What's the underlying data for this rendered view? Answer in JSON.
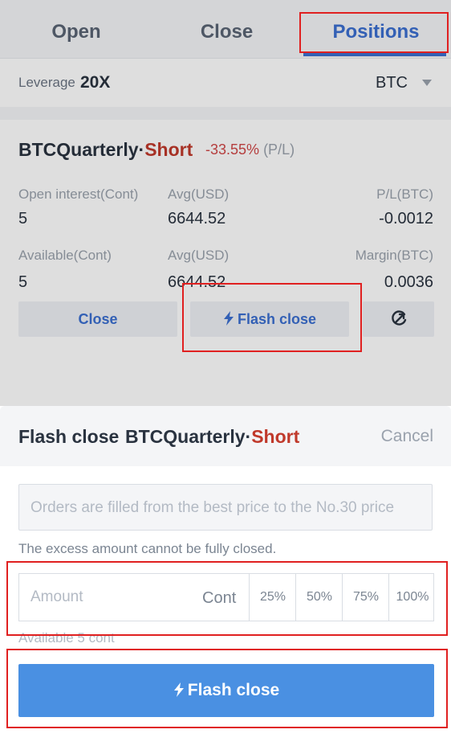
{
  "tabs": [
    {
      "label": "Open"
    },
    {
      "label": "Close"
    },
    {
      "label": "Positions"
    }
  ],
  "leverage": {
    "label": "Leverage",
    "value": "20X",
    "coin": "BTC"
  },
  "position": {
    "contract": "BTCQuarterly·",
    "side": "Short",
    "pl_percent": "-33.55%",
    "pl_suffix": "(P/L)",
    "fields": {
      "open_interest_label": "Open interest(Cont)",
      "open_interest_value": "5",
      "avg1_label": "Avg(USD)",
      "avg1_value": "6644.52",
      "pl_btc_label": "P/L(BTC)",
      "pl_btc_value": "-0.0012",
      "available_label": "Available(Cont)",
      "available_value": "5",
      "avg2_label": "Avg(USD)",
      "avg2_value": "6644.52",
      "margin_label": "Margin(BTC)",
      "margin_value": "0.0036"
    },
    "buttons": {
      "close": "Close",
      "flash_close": "Flash close"
    }
  },
  "sheet": {
    "title": "Flash close",
    "contract": "BTCQuarterly·",
    "side": "Short",
    "cancel": "Cancel",
    "order_info": "Orders are filled from the best price to the No.30 price",
    "hint": "The excess amount cannot be fully closed.",
    "amount_placeholder": "Amount",
    "amount_unit": "Cont",
    "percents": [
      "25%",
      "50%",
      "75%",
      "100%"
    ],
    "available": "Available 5 cont",
    "submit": "Flash close"
  },
  "colors": {
    "accent": "#3b6fd0",
    "button_blue": "#4a90e2",
    "short_red": "#c0392b",
    "highlight_red": "#e02020"
  }
}
